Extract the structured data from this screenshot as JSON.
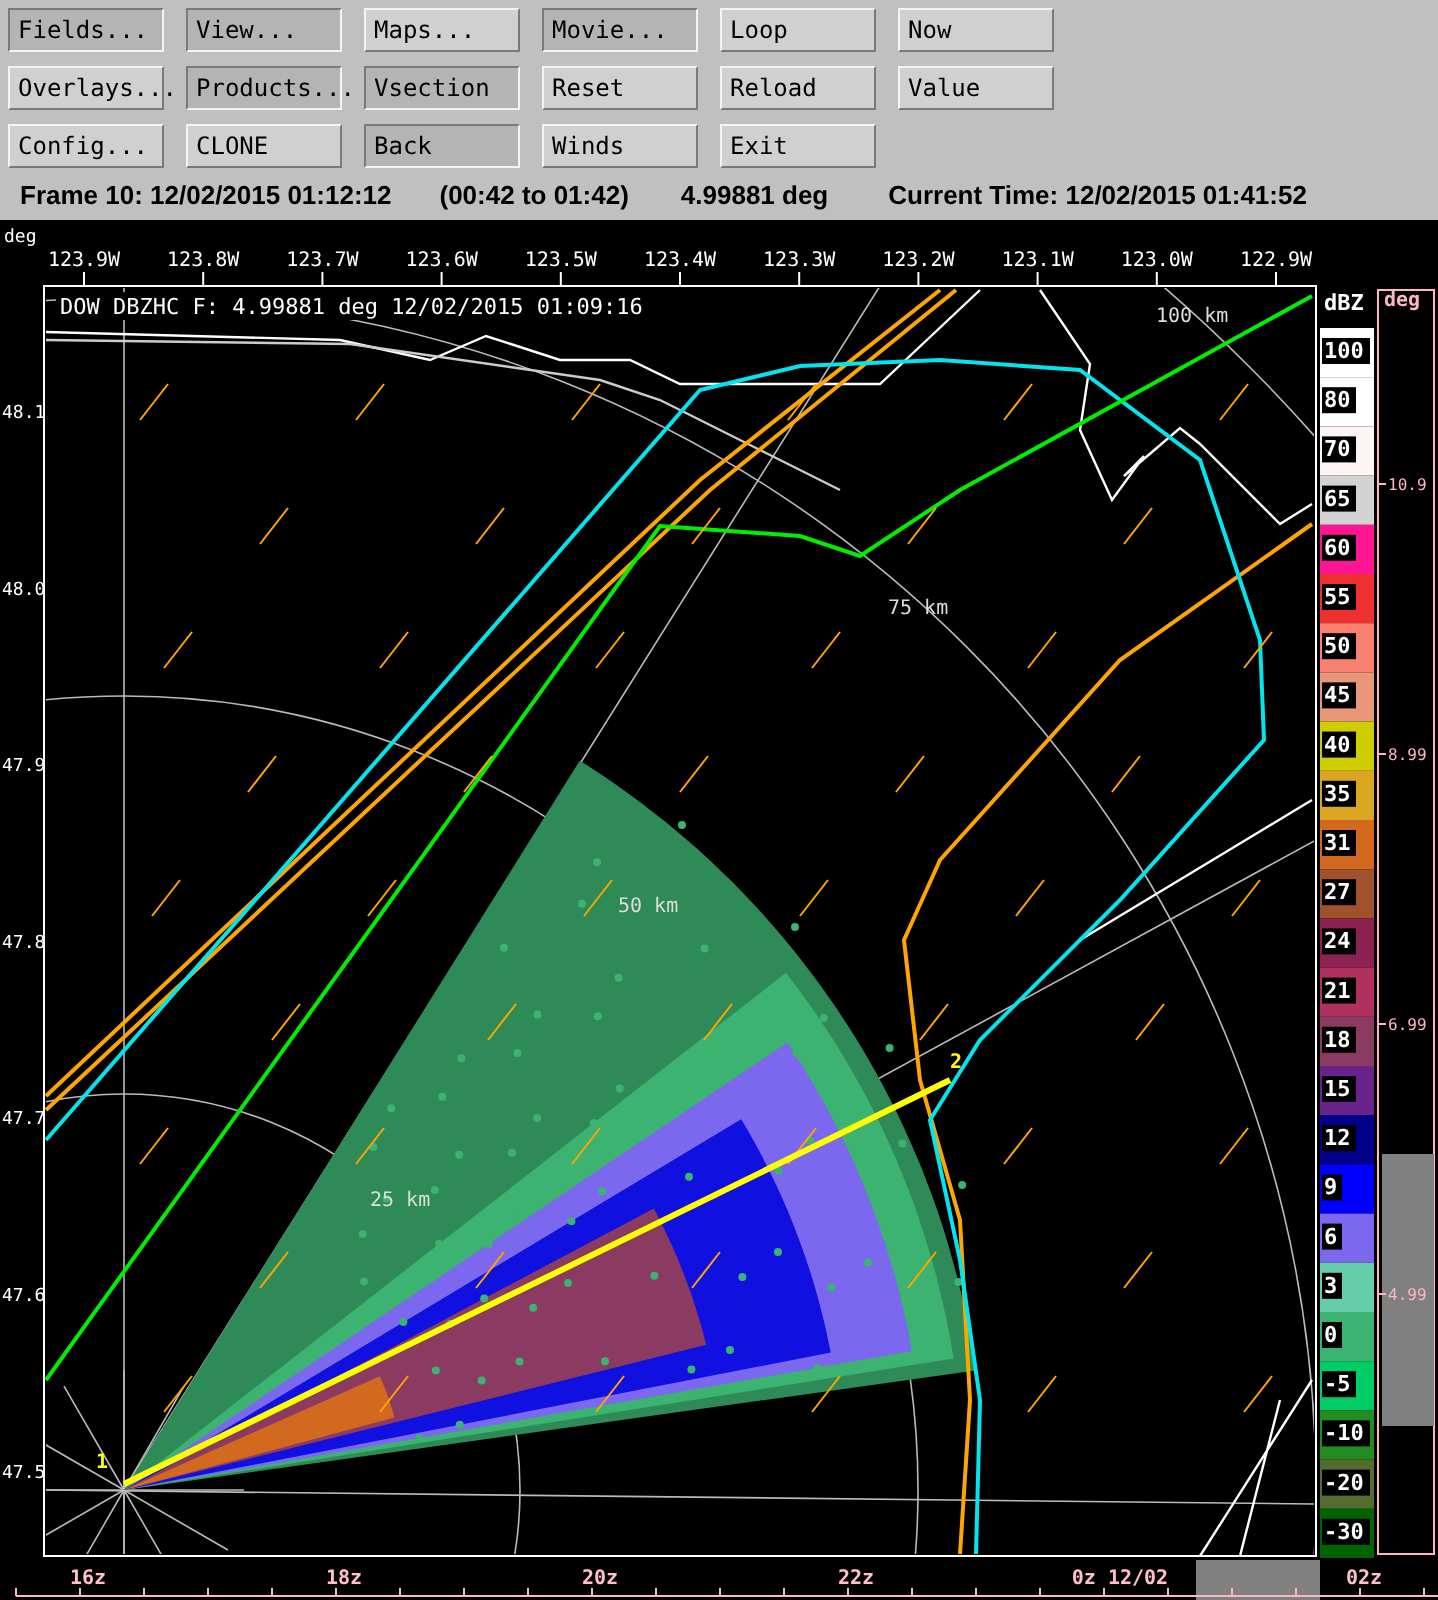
{
  "buttons": [
    [
      {
        "label": "Fields...",
        "pressed": true
      },
      {
        "label": "View...",
        "pressed": true
      },
      {
        "label": "Maps...",
        "pressed": false
      },
      {
        "label": "Movie...",
        "pressed": true
      },
      {
        "label": "Loop",
        "pressed": false
      },
      {
        "label": "Now",
        "pressed": false
      }
    ],
    [
      {
        "label": "Overlays...",
        "pressed": false
      },
      {
        "label": "Products...",
        "pressed": true
      },
      {
        "label": "Vsection",
        "pressed": true
      },
      {
        "label": "Reset",
        "pressed": false
      },
      {
        "label": "Reload",
        "pressed": false
      },
      {
        "label": "Value",
        "pressed": false
      }
    ],
    [
      {
        "label": "Config...",
        "pressed": false
      },
      {
        "label": "CLONE",
        "pressed": false
      },
      {
        "label": "Back",
        "pressed": true
      },
      {
        "label": "Winds",
        "pressed": false
      },
      {
        "label": "Exit",
        "pressed": false
      }
    ]
  ],
  "status": {
    "frame": "Frame 10: 12/02/2015 01:12:12",
    "range": "(00:42 to 01:42)",
    "angle": "4.99881 deg",
    "current_time": "Current Time: 12/02/2015 01:41:52"
  },
  "plot": {
    "units": "deg",
    "title": "DOW DBZHC F: 4.99881 deg 12/02/2015 01:09:16",
    "x_ticks": [
      "123.9W",
      "123.8W",
      "123.7W",
      "123.6W",
      "123.5W",
      "123.4W",
      "123.3W",
      "123.2W",
      "123.1W",
      "123.0W",
      "122.9W"
    ],
    "y_ticks": [
      "48.1",
      "48.0",
      "47.9",
      "47.8",
      "47.7",
      "47.6",
      "47.5"
    ],
    "range_rings": [
      "25 km",
      "50 km",
      "75 km",
      "100 km"
    ],
    "markers": [
      "1",
      "2"
    ]
  },
  "color_scale": {
    "title": "dBZ",
    "entries": [
      {
        "label": "100",
        "color": "#ffffff"
      },
      {
        "label": "80",
        "color": "#ffffff"
      },
      {
        "label": "70",
        "color": "#fff4f4"
      },
      {
        "label": "65",
        "color": "#d3d3d3"
      },
      {
        "label": "60",
        "color": "#ff1493"
      },
      {
        "label": "55",
        "color": "#ee3030"
      },
      {
        "label": "50",
        "color": "#fa8072"
      },
      {
        "label": "45",
        "color": "#e9967a"
      },
      {
        "label": "40",
        "color": "#cdcd00"
      },
      {
        "label": "35",
        "color": "#daa520"
      },
      {
        "label": "31",
        "color": "#d2691e"
      },
      {
        "label": "27",
        "color": "#a0522d"
      },
      {
        "label": "24",
        "color": "#8b2252"
      },
      {
        "label": "21",
        "color": "#b03060"
      },
      {
        "label": "18",
        "color": "#8b3a62"
      },
      {
        "label": "15",
        "color": "#68228b"
      },
      {
        "label": "12",
        "color": "#00008b"
      },
      {
        "label": "9",
        "color": "#0000ff"
      },
      {
        "label": "6",
        "color": "#7b68ee"
      },
      {
        "label": "3",
        "color": "#66cdaa"
      },
      {
        "label": "0",
        "color": "#3cb371"
      },
      {
        "label": "-5",
        "color": "#00cd66"
      },
      {
        "label": "-10",
        "color": "#228b22"
      },
      {
        "label": "-20",
        "color": "#556b2f"
      },
      {
        "label": "-30",
        "color": "#006400"
      }
    ]
  },
  "height_scale": {
    "title": "deg",
    "ticks": [
      "10.9",
      "8.99",
      "6.99",
      "4.99"
    ]
  },
  "timeline": {
    "labels": [
      "16z",
      "18z",
      "20z",
      "22z",
      "0z 12/02",
      "02z"
    ]
  }
}
